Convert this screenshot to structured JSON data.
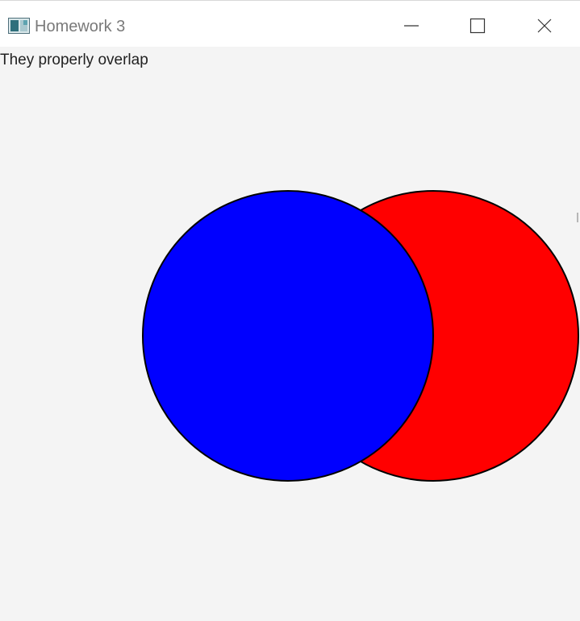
{
  "window": {
    "title": "Homework 3",
    "controls": {
      "minimize_icon": "minimize-icon",
      "maximize_icon": "maximize-icon",
      "close_icon": "close-icon"
    }
  },
  "content": {
    "status_text": "They properly overlap"
  },
  "colors": {
    "blue_circle_fill": "#0000ff",
    "red_circle_fill": "#ff0000",
    "circle_stroke": "#000000",
    "background": "#f4f4f4"
  }
}
